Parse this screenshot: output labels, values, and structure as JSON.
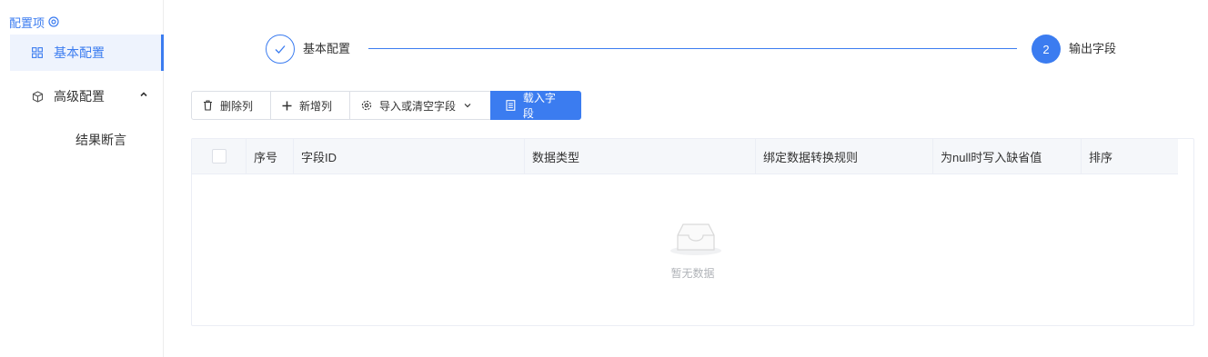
{
  "sidebar": {
    "title": "配置项",
    "items": [
      {
        "label": "基本配置",
        "icon": "grid-icon",
        "active": true
      },
      {
        "label": "高级配置",
        "icon": "cube-icon",
        "expanded": true,
        "children": [
          {
            "label": "结果断言"
          }
        ]
      }
    ]
  },
  "steps": [
    {
      "label": "基本配置",
      "status": "done"
    },
    {
      "number": "2",
      "label": "输出字段",
      "status": "current"
    }
  ],
  "toolbar": {
    "delete_column": "删除列",
    "add_column": "新增列",
    "import_or_clear": "导入或清空字段",
    "load_fields": "载入字段"
  },
  "table": {
    "columns": [
      "序号",
      "字段ID",
      "数据类型",
      "绑定数据转换规则",
      "为null时写入缺省值",
      "排序"
    ],
    "rows": [],
    "empty_text": "暂无数据"
  },
  "colors": {
    "accent": "#3b7cf0",
    "border": "#ebeef5",
    "header_bg": "#f5f7fa"
  }
}
